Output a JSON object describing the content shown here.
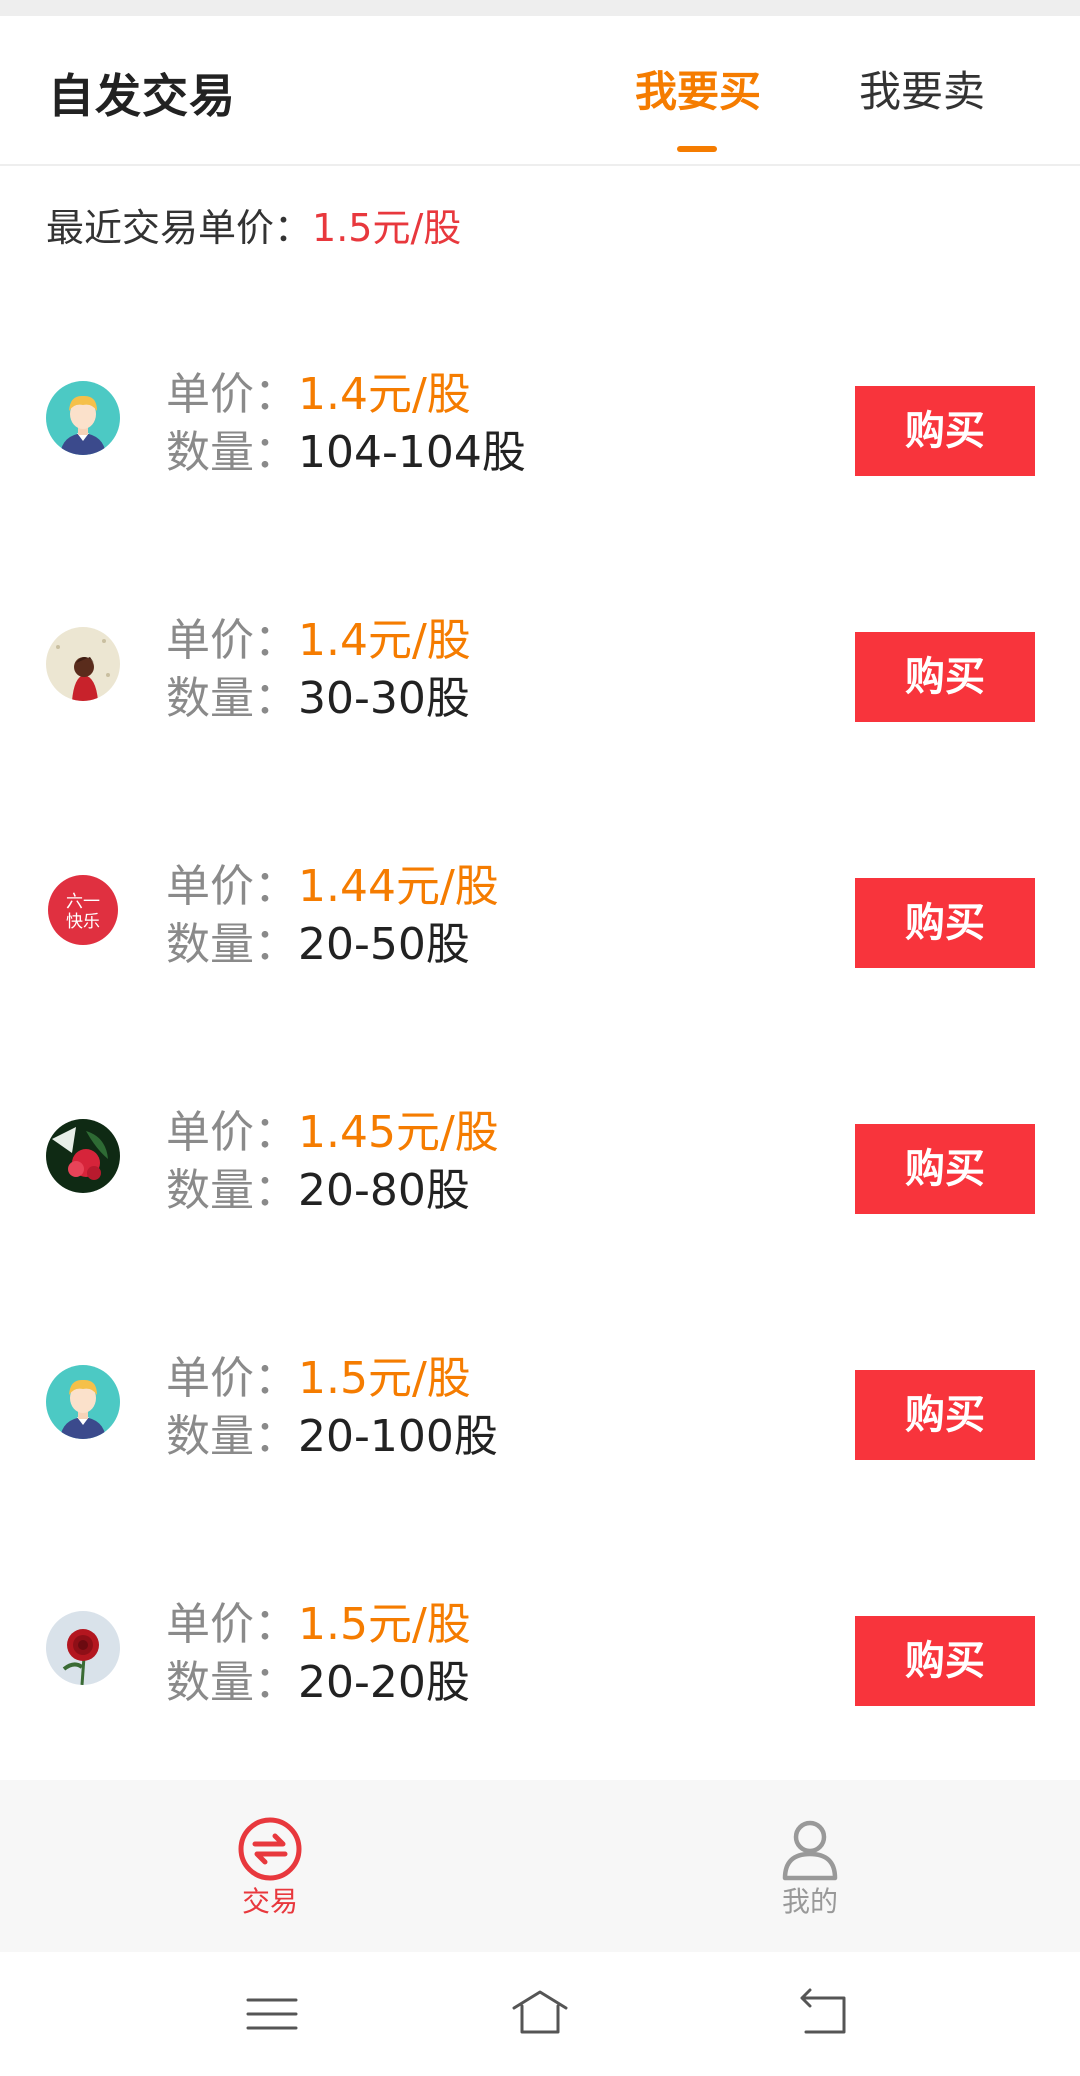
{
  "header": {
    "title": "自发交易",
    "tabs": [
      {
        "label": "我要买",
        "active": true
      },
      {
        "label": "我要卖",
        "active": false
      }
    ]
  },
  "recent": {
    "label": "最近交易单价：",
    "value": "1.5元/股"
  },
  "listings": [
    {
      "avatar": "avatar-boy-icon",
      "price_label": "单价：",
      "price": "1.4元/股",
      "qty_label": "数量：",
      "qty": "104-104股",
      "button": "购买"
    },
    {
      "avatar": "avatar-girl-icon",
      "price_label": "单价：",
      "price": "1.4元/股",
      "qty_label": "数量：",
      "qty": "30-30股",
      "button": "购买"
    },
    {
      "avatar": "avatar-badge-icon",
      "badge_text": "六一快乐",
      "price_label": "单价：",
      "price": "1.44元/股",
      "qty_label": "数量：",
      "qty": "20-50股",
      "button": "购买"
    },
    {
      "avatar": "avatar-flower-icon",
      "price_label": "单价：",
      "price": "1.45元/股",
      "qty_label": "数量：",
      "qty": "20-80股",
      "button": "购买"
    },
    {
      "avatar": "avatar-boy-icon",
      "price_label": "单价：",
      "price": "1.5元/股",
      "qty_label": "数量：",
      "qty": "20-100股",
      "button": "购买"
    },
    {
      "avatar": "avatar-rose-icon",
      "price_label": "单价：",
      "price": "1.5元/股",
      "qty_label": "数量：",
      "qty": "20-20股",
      "button": "购买"
    }
  ],
  "tabbar": {
    "items": [
      {
        "label": "交易",
        "icon": "exchange-icon",
        "active": true
      },
      {
        "label": "我的",
        "icon": "user-icon",
        "active": false
      }
    ]
  },
  "colors": {
    "accent_orange": "#f57c00",
    "accent_red": "#e8383d",
    "button_red": "#f8343c"
  },
  "sysnav": {
    "icons": [
      "menu-icon",
      "home-icon",
      "back-icon"
    ]
  }
}
